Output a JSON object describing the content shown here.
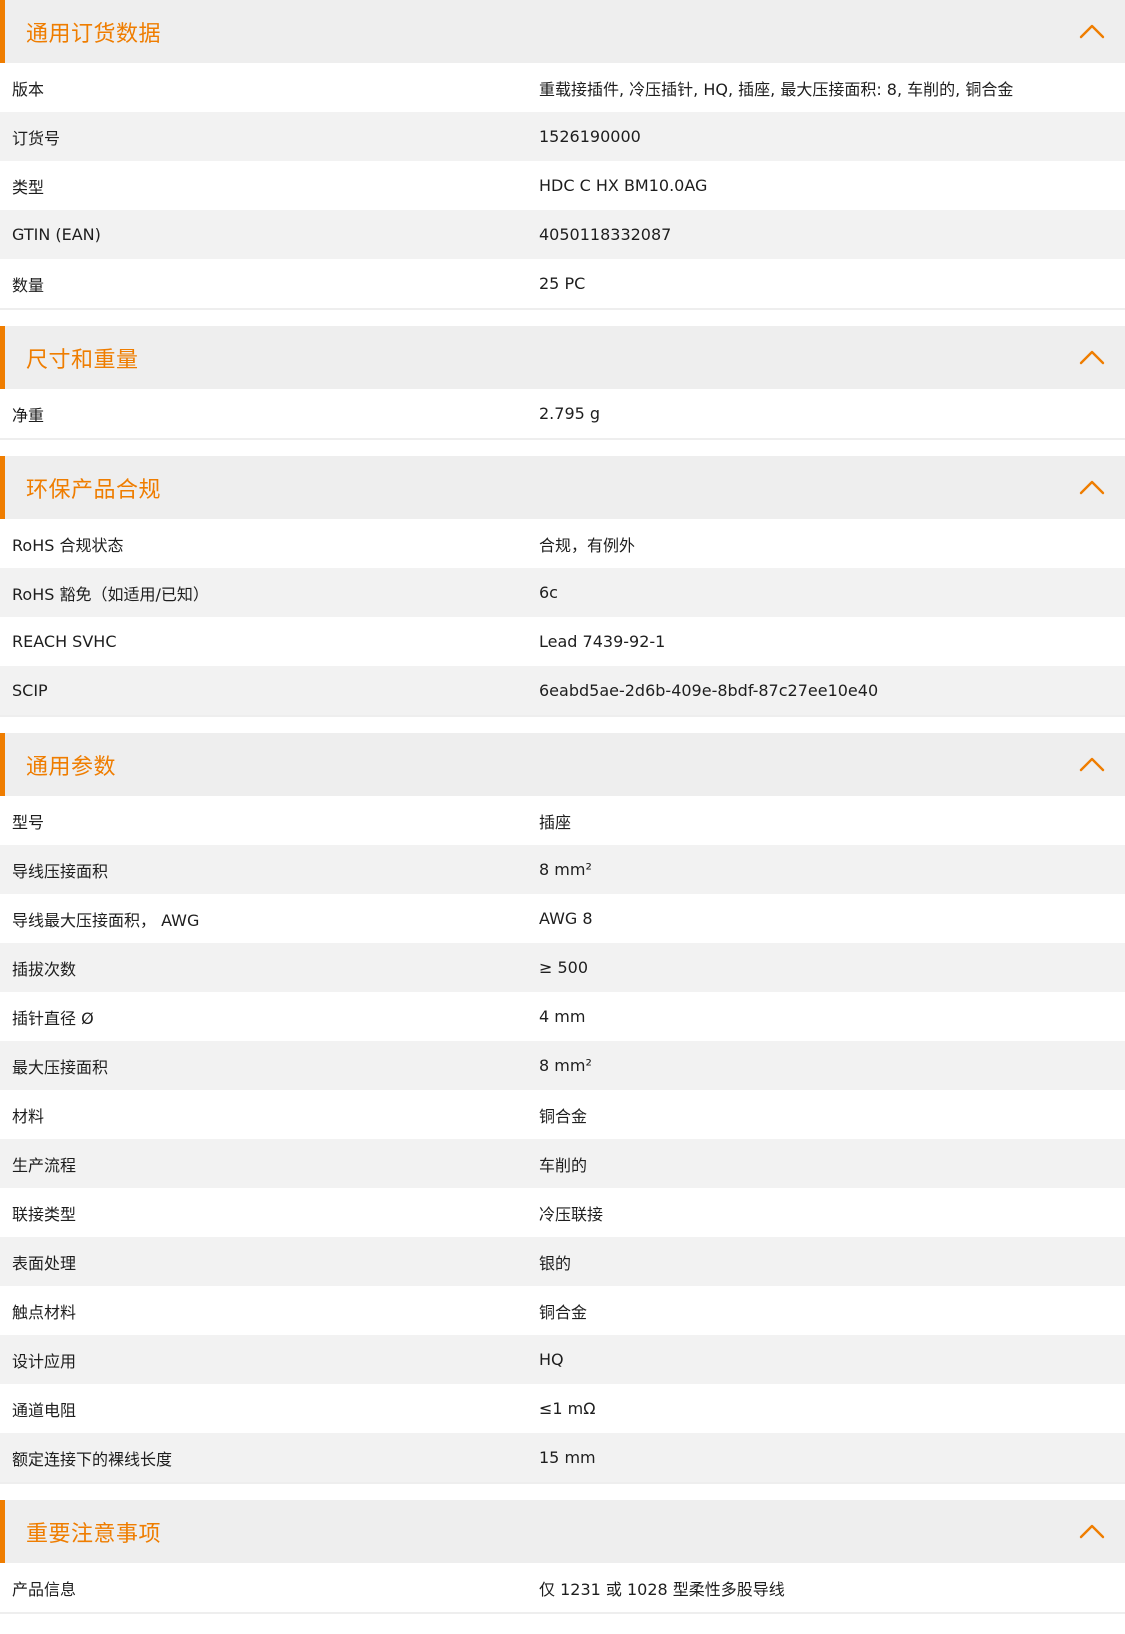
{
  "accent_color": "#ef7d00",
  "collapse_icon": "chevron-up-icon",
  "sections": [
    {
      "title": "通用订货数据",
      "rows": [
        {
          "label": "版本",
          "value": "重载接插件, 冷压插针, HQ, 插座, 最大压接面积: 8, 车削的, 铜合金"
        },
        {
          "label": "订货号",
          "value": "1526190000"
        },
        {
          "label": "类型",
          "value": "HDC C HX BM10.0AG"
        },
        {
          "label": "GTIN (EAN)",
          "value": "4050118332087"
        },
        {
          "label": "数量",
          "value": "25  PC"
        }
      ]
    },
    {
      "title": "尺寸和重量",
      "rows": [
        {
          "label": "净重",
          "value": "2.795  g"
        }
      ]
    },
    {
      "title": "环保产品合规",
      "rows": [
        {
          "label": "RoHS 合规状态",
          "value": "合规，有例外"
        },
        {
          "label": "RoHS 豁免（如适用/已知）",
          "value": "6c"
        },
        {
          "label": "REACH SVHC",
          "value": "Lead 7439-92-1"
        },
        {
          "label": "SCIP",
          "value": "6eabd5ae-2d6b-409e-8bdf-87c27ee10e40"
        }
      ]
    },
    {
      "title": "通用参数",
      "rows": [
        {
          "label": "型号",
          "value": "插座"
        },
        {
          "label": "导线压接面积",
          "value": "8 mm²"
        },
        {
          "label": "导线最大压接面积， AWG",
          "value": "AWG 8"
        },
        {
          "label": "插拔次数",
          "value": "≥ 500"
        },
        {
          "label": "插针直径 Ø",
          "value": "4  mm"
        },
        {
          "label": "最大压接面积",
          "value": "8  mm²"
        },
        {
          "label": "材料",
          "value": "铜合金"
        },
        {
          "label": "生产流程",
          "value": "车削的"
        },
        {
          "label": "联接类型",
          "value": "冷压联接"
        },
        {
          "label": "表面处理",
          "value": "银的"
        },
        {
          "label": "触点材料",
          "value": "铜合金"
        },
        {
          "label": "设计应用",
          "value": "HQ"
        },
        {
          "label": "通道电阻",
          "value": "≤1 mΩ"
        },
        {
          "label": "额定连接下的裸线长度",
          "value": "15  mm"
        }
      ]
    },
    {
      "title": "重要注意事项",
      "rows": [
        {
          "label": "产品信息",
          "value": "仅 1231 或 1028 型柔性多股导线"
        }
      ]
    }
  ]
}
